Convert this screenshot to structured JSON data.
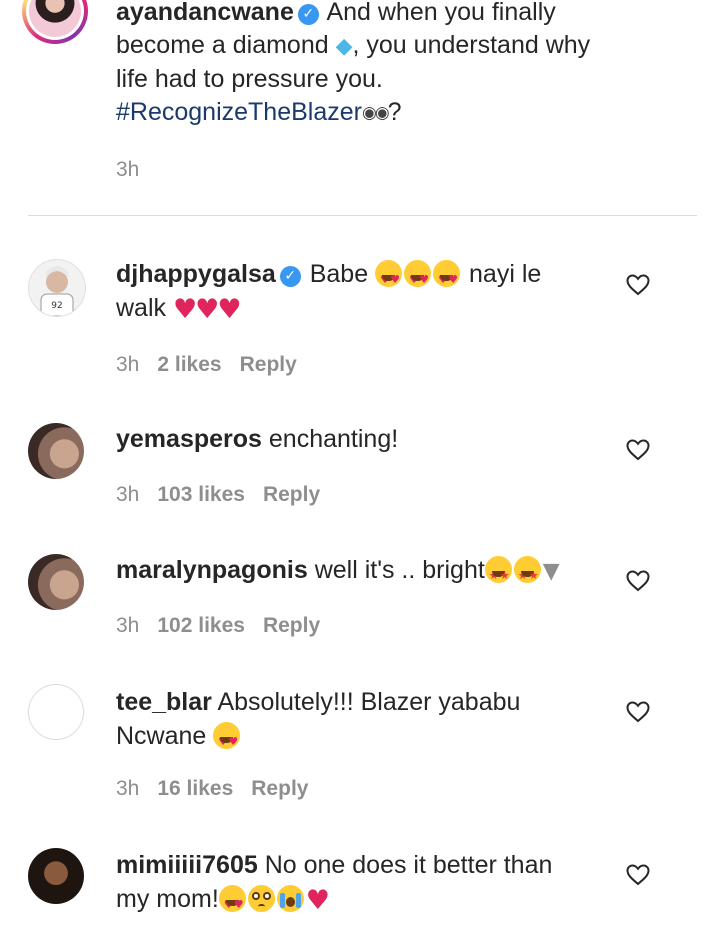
{
  "caption": {
    "username": "ayandancwane",
    "text_line1": "And when you finally",
    "text_line2a": "become a diamond",
    "text_line2b": ", you understand why",
    "text_line3": "life had to pressure you.",
    "hashtag": "#RecognizeTheBlazer",
    "text_end": "?",
    "time": "3h"
  },
  "comments": [
    {
      "username": "djhappygalsa",
      "verified": true,
      "text_a": "Babe",
      "text_b": "nayi le",
      "text_c": "walk",
      "time": "3h",
      "likes": "2 likes",
      "reply": "Reply"
    },
    {
      "username": "yemasperos",
      "text": "enchanting!",
      "time": "3h",
      "likes": "103 likes",
      "reply": "Reply"
    },
    {
      "username": "maralynpagonis",
      "text": "well it's .. bright",
      "time": "3h",
      "likes": "102 likes",
      "reply": "Reply"
    },
    {
      "username": "tee_blar",
      "text_a": "Absolutely!!! Blazer yababu",
      "text_b": "Ncwane",
      "time": "3h",
      "likes": "16 likes",
      "reply": "Reply"
    },
    {
      "username": "mimiiiii7605",
      "text_a": "No one does it better than",
      "text_b": "my mom!"
    }
  ],
  "icons": {
    "verified": "verified-badge-icon",
    "like": "heart-outline-icon",
    "verified_glyph": "✓"
  },
  "colors": {
    "link": "#1b3a6b",
    "verified": "#3897f0",
    "secondary_text": "#8e8e8e"
  }
}
